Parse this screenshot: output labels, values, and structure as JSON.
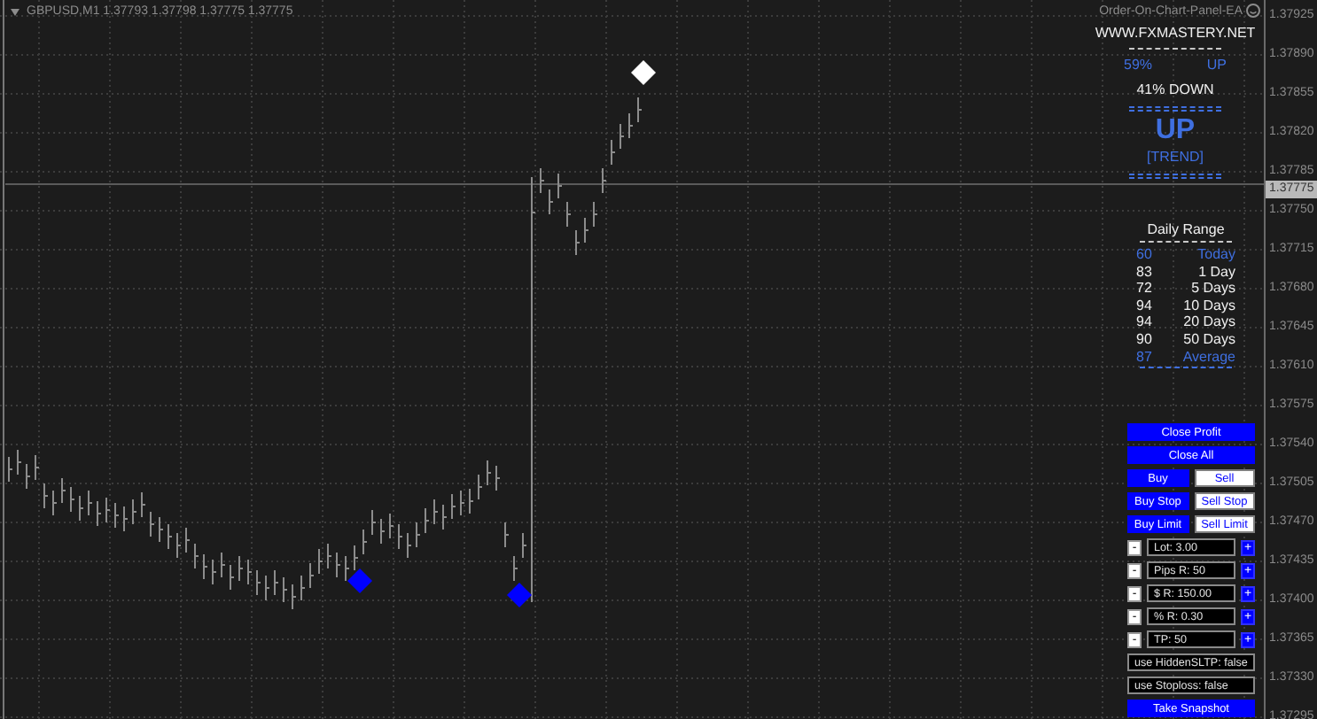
{
  "chart": {
    "title": "GBPUSD,M1 1.37793 1.37798 1.37775 1.37775",
    "ea_label": "Order-On-Chart-Panel-EA",
    "current_price": "1.37775",
    "price_axis": [
      "1.37925",
      "1.37890",
      "1.37855",
      "1.37820",
      "1.37785",
      "1.37750",
      "1.37715",
      "1.37680",
      "1.37645",
      "1.37610",
      "1.37575",
      "1.37540",
      "1.37505",
      "1.37470",
      "1.37435",
      "1.37400",
      "1.37365",
      "1.37330",
      "1.37295"
    ]
  },
  "signal_panel": {
    "website": "WWW.FXMASTERY.NET",
    "up_percent": "59%",
    "up_label": "UP",
    "down_text": "41% DOWN",
    "trend": "UP",
    "trend_label": "[TREND]"
  },
  "daily_range": {
    "title": "Daily Range",
    "rows": [
      {
        "value": "60",
        "label": "Today",
        "color": "#3f6fe0"
      },
      {
        "value": "83",
        "label": "1 Day",
        "color": "#f0f0f0"
      },
      {
        "value": "72",
        "label": "5 Days",
        "color": "#f0f0f0"
      },
      {
        "value": "94",
        "label": "10 Days",
        "color": "#f0f0f0"
      },
      {
        "value": "94",
        "label": "20 Days",
        "color": "#f0f0f0"
      },
      {
        "value": "90",
        "label": "50 Days",
        "color": "#f0f0f0"
      },
      {
        "value": "87",
        "label": "Average",
        "color": "#3f6fe0"
      }
    ]
  },
  "order_panel": {
    "close_buttons": [
      "Close Profit",
      "Close All"
    ],
    "order_buttons": [
      {
        "label": "Buy",
        "kind": "primary"
      },
      {
        "label": "Sell",
        "kind": "secondary"
      },
      {
        "label": "Buy Stop",
        "kind": "primary"
      },
      {
        "label": "Sell Stop",
        "kind": "secondary"
      },
      {
        "label": "Buy Limit",
        "kind": "primary"
      },
      {
        "label": "Sell Limit",
        "kind": "secondary"
      }
    ],
    "steppers": [
      {
        "minus": "-",
        "value": "Lot: 3.00",
        "plus": "+"
      },
      {
        "minus": "-",
        "value": "Pips R: 50",
        "plus": "+"
      },
      {
        "minus": "-",
        "value": "$ R: 150.00",
        "plus": "+"
      },
      {
        "minus": "-",
        "value": "% R: 0.30",
        "plus": "+"
      },
      {
        "minus": "-",
        "value": "TP: 50",
        "plus": "+"
      }
    ],
    "toggles": [
      "use HiddenSLTP: false",
      "use Stoploss: false"
    ],
    "snapshot": "Take Snapshot"
  }
}
